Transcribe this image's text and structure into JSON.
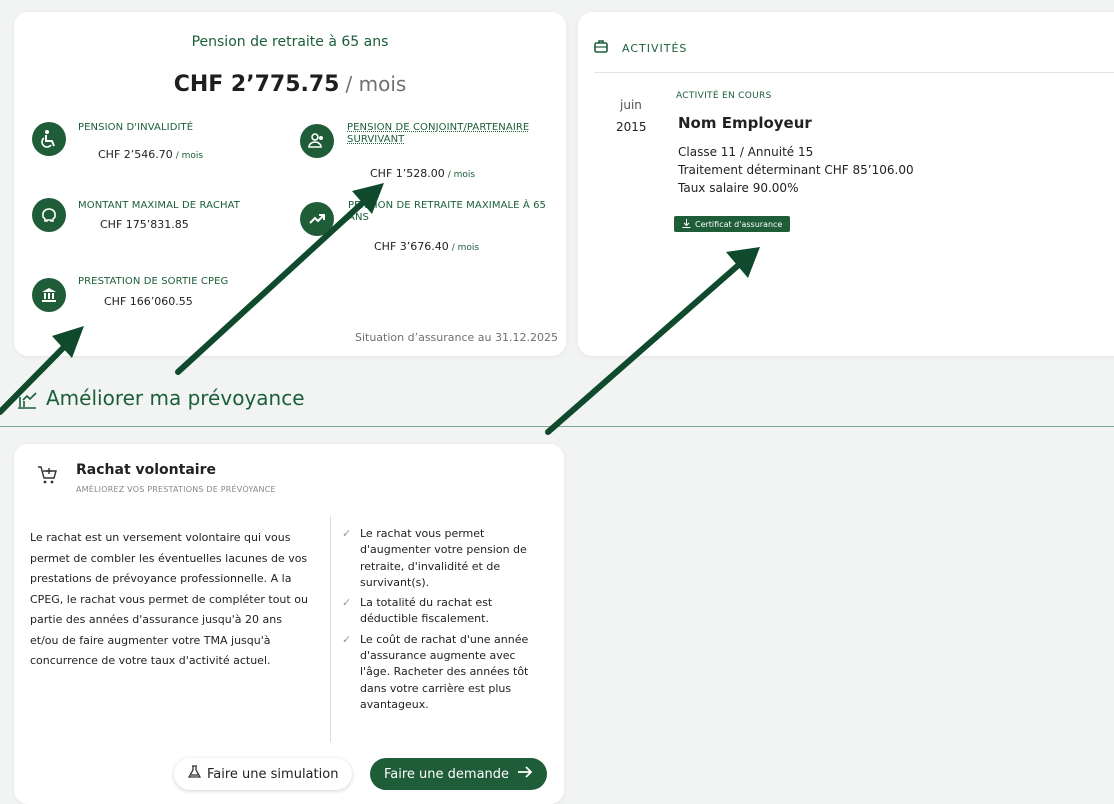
{
  "pension": {
    "title": "Pension de retraite à 65 ans",
    "amount": "CHF 2’775.75",
    "amount_unit": "/ mois",
    "items": [
      {
        "label": "PENSION D'INVALIDITÉ",
        "value": "CHF 2’546.70",
        "unit": "/ mois",
        "icon": "wheelchair-icon"
      },
      {
        "label": "PENSION DE CONJOINT/PARTENAIRE SURVIVANT",
        "value": "CHF 1’528.00",
        "unit": "/ mois",
        "icon": "people-icon"
      },
      {
        "label": "MONTANT MAXIMAL DE RACHAT",
        "value": "CHF 175’831.85",
        "unit": "",
        "icon": "piggy-bank-icon"
      },
      {
        "label": "PENSION DE RETRAITE MAXIMALE À 65 ANS",
        "value": "CHF 3’676.40",
        "unit": "/ mois",
        "icon": "trend-up-icon"
      },
      {
        "label": "PRESTATION DE SORTIE CPEG",
        "value": "CHF 166’060.55",
        "unit": "",
        "icon": "bank-icon"
      }
    ],
    "situation": "Situation d’assurance au 31.12.2025"
  },
  "activities": {
    "header": "ACTIVITÉS",
    "month": "juin",
    "year": "2015",
    "status": "ACTIVITÉ EN COURS",
    "employer": "Nom Employeur",
    "class": "Classe 11 / Annuité 15",
    "salary": "Traitement déterminant CHF 85’106.00",
    "rate": "Taux salaire 90.00%",
    "certificate_button": "Certificat d'assurance"
  },
  "improve": {
    "title": "Améliorer ma prévoyance"
  },
  "rachat": {
    "title": "Rachat volontaire",
    "subtitle": "AMÉLIOREZ VOS PRESTATIONS DE PRÉVOYANCE",
    "description": "Le rachat est un versement volontaire qui vous permet de combler les éventuelles lacunes de vos prestations de prévoyance professionnelle. A la CPEG, le rachat vous permet de compléter tout ou partie des années d'assurance jusqu'à 20 ans et/ou de faire augmenter votre TMA jusqu'à concurrence de votre taux d'activité actuel.",
    "benefits": [
      "Le rachat vous permet d'augmenter votre pension de retraite, d'invalidité et de survivant(s).",
      "La totalité du rachat est déductible fiscalement.",
      "Le coût de rachat d'une année d'assurance augmente avec l'âge. Racheter des années tôt dans votre carrière est plus avantageux."
    ],
    "simulate_button": "Faire une simulation",
    "request_button": "Faire une demande"
  },
  "colors": {
    "accent": "#1f5c38",
    "annotation_arrow": "#0f4a2c"
  }
}
